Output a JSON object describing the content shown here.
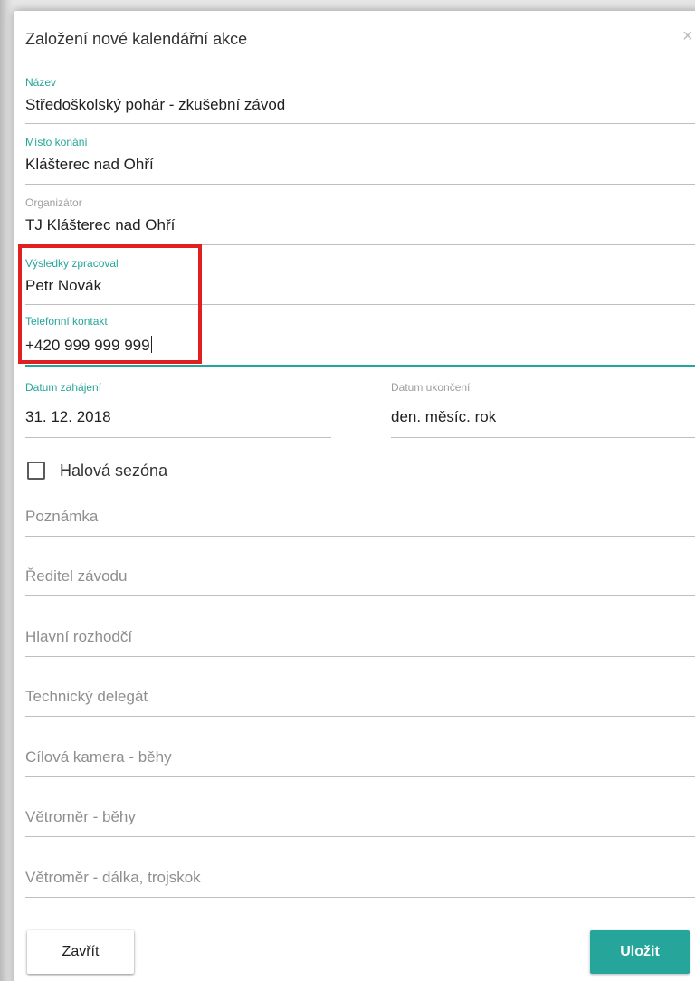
{
  "dialog": {
    "title": "Založení nové kalendářní akce",
    "close_glyph": "×"
  },
  "fields": {
    "nazev": {
      "label": "Název",
      "value": "Středoškolský pohár - zkušební závod"
    },
    "misto": {
      "label": "Místo konání",
      "value": "Klášterec nad Ohří"
    },
    "organizator": {
      "label": "Organizátor",
      "value": "TJ Klášterec nad Ohří"
    },
    "vysledky": {
      "label": "Výsledky zpracoval",
      "value": "Petr Novák"
    },
    "telefon": {
      "label": "Telefonní kontakt",
      "value": "+420 999 999 999"
    },
    "datum_zahajeni": {
      "label": "Datum zahájení",
      "value": "31. 12. 2018"
    },
    "datum_ukonceni": {
      "label": "Datum ukončení",
      "value": "den. měsíc. rok"
    }
  },
  "checkbox": {
    "label": "Halová sezóna",
    "checked": false
  },
  "placeholders": {
    "poznamka": "Poznámka",
    "reditel": "Ředitel závodu",
    "rozhodci": "Hlavní rozhodčí",
    "delegat": "Technický delegát",
    "kamera": "Cílová kamera - běhy",
    "vetromer_behy": "Větroměr - běhy",
    "vetromer_dalka": "Větroměr - dálka, trojskok"
  },
  "buttons": {
    "close": "Zavřít",
    "save": "Uložit"
  },
  "colors": {
    "accent": "#26a69a",
    "highlight": "#e02020"
  }
}
